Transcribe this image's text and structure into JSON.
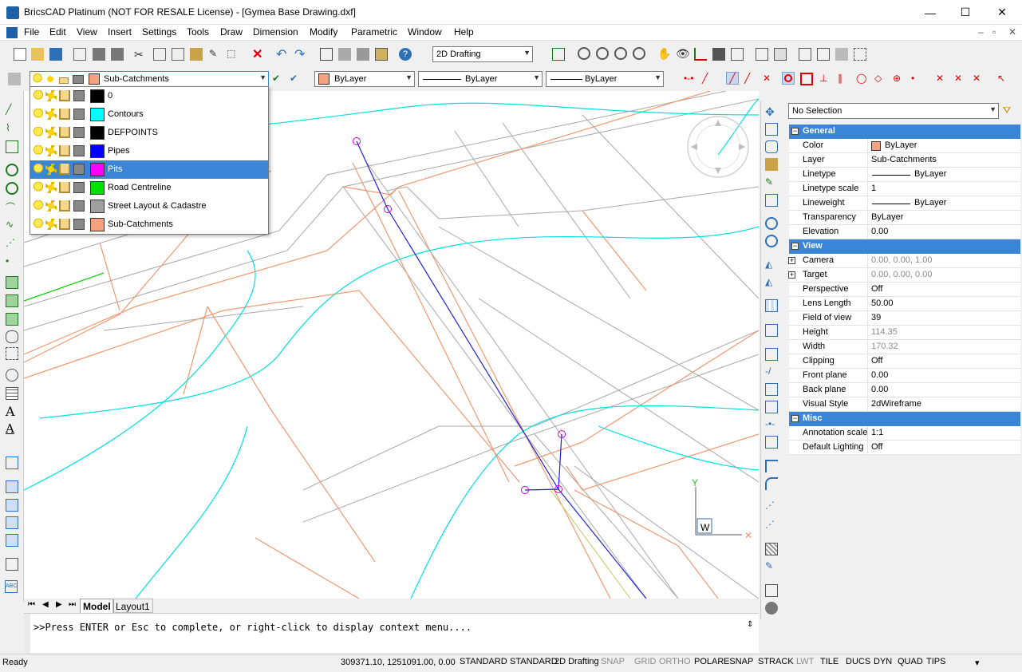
{
  "window": {
    "title": "BricsCAD Platinum (NOT FOR RESALE License) - [Gymea Base Drawing.dxf]",
    "minimize": "—",
    "maximize": "☐",
    "close": "✕"
  },
  "menu": [
    "File",
    "Edit",
    "View",
    "Insert",
    "Settings",
    "Tools",
    "Draw",
    "Dimension",
    "Modify",
    "Parametric",
    "Window",
    "Help"
  ],
  "toolbar": {
    "workspace": "2D Drafting"
  },
  "layer_toolbar": {
    "current_layer": "Sub-Catchments",
    "current_layer_color": "#f4a280",
    "color": "ByLayer",
    "linetype": "ByLayer",
    "lineweight": "ByLayer"
  },
  "layer_list": [
    {
      "name": "0",
      "color": "#000000"
    },
    {
      "name": "Contours",
      "color": "#00ffff"
    },
    {
      "name": "DEFPOINTS",
      "color": "#000000"
    },
    {
      "name": "Pipes",
      "color": "#0000ff"
    },
    {
      "name": "Pits",
      "color": "#ff00ff",
      "selected": true
    },
    {
      "name": "Road Centreline",
      "color": "#00e000"
    },
    {
      "name": "Street Layout & Cadastre",
      "color": "#a0a0a0"
    },
    {
      "name": "Sub-Catchments",
      "color": "#f4a280"
    }
  ],
  "properties": {
    "selection": "No Selection",
    "sections": [
      {
        "title": "General",
        "rows": [
          {
            "key": "Color",
            "value": "ByLayer",
            "swatch": "#f4a280"
          },
          {
            "key": "Layer",
            "value": "Sub-Catchments"
          },
          {
            "key": "Linetype",
            "value": "ByLayer",
            "line": true
          },
          {
            "key": "Linetype scale",
            "value": "1"
          },
          {
            "key": "Lineweight",
            "value": "ByLayer",
            "line": true
          },
          {
            "key": "Transparency",
            "value": "ByLayer"
          },
          {
            "key": "Elevation",
            "value": "0.00"
          }
        ]
      },
      {
        "title": "View",
        "rows": [
          {
            "key": "Camera",
            "value": "0.00, 0.00, 1.00",
            "grey": true,
            "expand": true
          },
          {
            "key": "Target",
            "value": "0.00, 0.00, 0.00",
            "grey": true,
            "expand": true
          },
          {
            "key": "Perspective",
            "value": "Off"
          },
          {
            "key": "Lens Length",
            "value": "50.00"
          },
          {
            "key": "Field of view",
            "value": "39"
          },
          {
            "key": "Height",
            "value": "114.35",
            "grey": true
          },
          {
            "key": "Width",
            "value": "170.32",
            "grey": true
          },
          {
            "key": "Clipping",
            "value": "Off"
          },
          {
            "key": "Front plane",
            "value": "0.00"
          },
          {
            "key": "Back plane",
            "value": "0.00"
          },
          {
            "key": "Visual Style",
            "value": "2dWireframe"
          }
        ]
      },
      {
        "title": "Misc",
        "rows": [
          {
            "key": "Annotation scale",
            "value": "1:1"
          },
          {
            "key": "Default Lighting",
            "value": "Off"
          }
        ]
      }
    ]
  },
  "tabs": {
    "model": "Model",
    "layout": "Layout1"
  },
  "command": {
    "prompt": ">>Press ENTER or Esc to complete, or right-click to display context menu...."
  },
  "ucs": {
    "y": "Y",
    "w": "W"
  },
  "status": {
    "ready": "Ready",
    "coords": "309371.10, 1251091.00, 0.00",
    "items": [
      {
        "label": "STANDARD",
        "on": true
      },
      {
        "label": "STANDARD",
        "on": true
      },
      {
        "label": "2D Drafting",
        "on": true
      },
      {
        "label": "SNAP",
        "on": false
      },
      {
        "label": "GRID",
        "on": false
      },
      {
        "label": "ORTHO",
        "on": false
      },
      {
        "label": "POLAR",
        "on": true
      },
      {
        "label": "ESNAP",
        "on": true
      },
      {
        "label": "STRACK",
        "on": true
      },
      {
        "label": "LWT",
        "on": false
      },
      {
        "label": "TILE",
        "on": true
      },
      {
        "label": "DUCS",
        "on": true
      },
      {
        "label": "DYN",
        "on": true
      },
      {
        "label": "QUAD",
        "on": true
      },
      {
        "label": "TIPS",
        "on": true
      }
    ]
  }
}
